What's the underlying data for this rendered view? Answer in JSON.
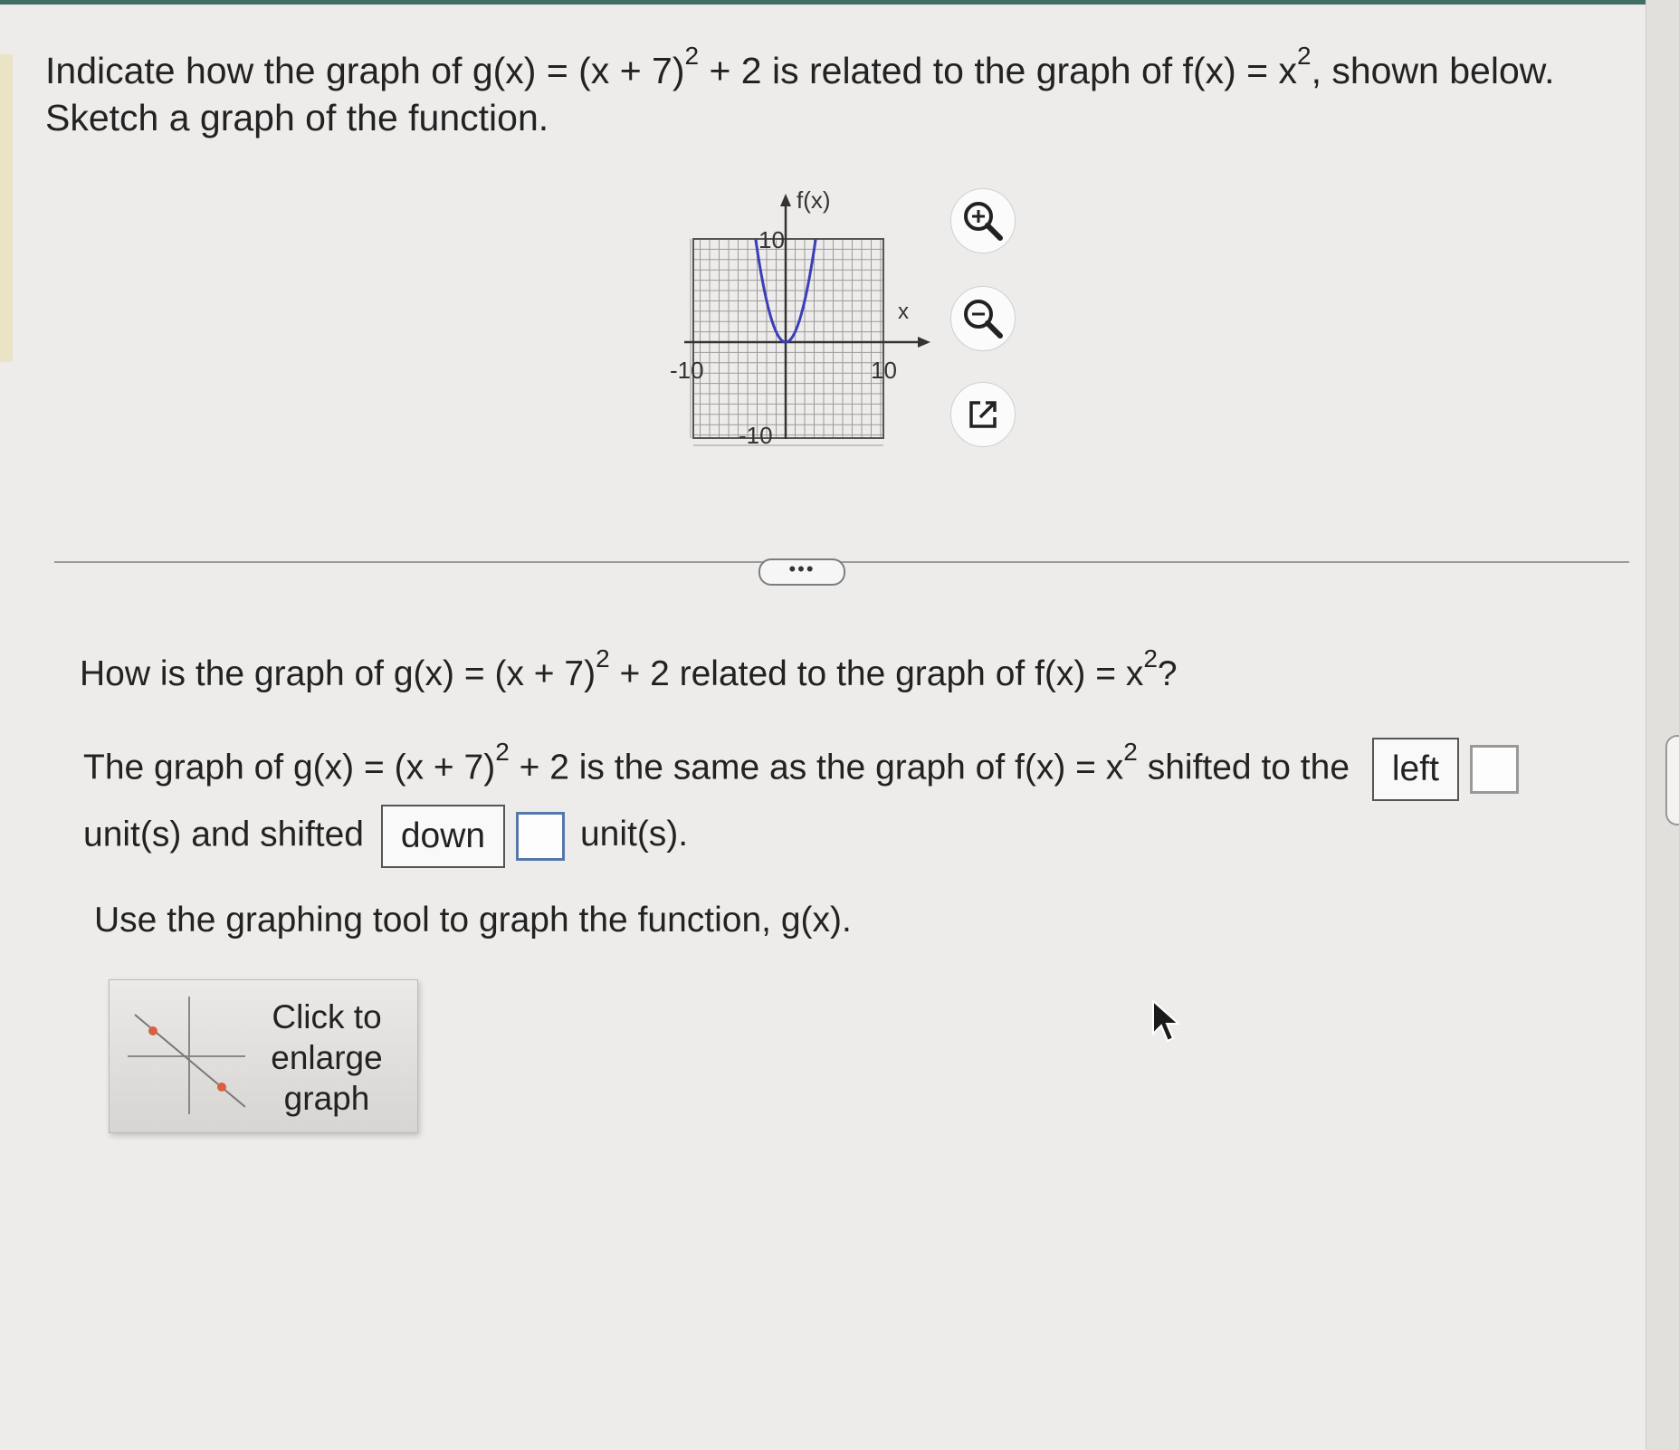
{
  "prompt": {
    "line1_a": "Indicate how the graph of g(x) = (x + 7)",
    "line1_exp1": "2",
    "line1_b": " + 2 is related to the graph of f(x) = x",
    "line1_exp2": "2",
    "line1_c": ", shown below.",
    "line2": "Sketch a graph of the function."
  },
  "graph": {
    "y_label": "f(x)",
    "x_label": "x",
    "x_min_label": "-10",
    "x_max_label": "10",
    "y_max_label": "10",
    "y_min_label": "-10",
    "curve_color": "#3a3fb8",
    "function": "x^2",
    "x_range": [
      -10,
      10
    ],
    "y_range": [
      -10,
      10
    ]
  },
  "tools": {
    "zoom_in": "zoom-in-icon",
    "zoom_out": "zoom-out-icon",
    "popout": "external-link-icon"
  },
  "divider": {
    "more_label": "•••"
  },
  "question": {
    "a": "How is the graph of g(x) = (x + 7)",
    "exp1": "2",
    "b": " + 2 related to the graph of f(x) = x",
    "exp2": "2",
    "c": "?"
  },
  "answer": {
    "a": "The graph of g(x) = (x + 7)",
    "exp1": "2",
    "b": " + 2 is the same as the graph of f(x) = x",
    "exp2": "2",
    "c": " shifted to the",
    "dir1_value": "left",
    "units1_value": "",
    "d": "unit(s) and shifted",
    "dir2_value": "down",
    "units2_value": "",
    "e": "unit(s)."
  },
  "instruction": "Use the graphing tool to graph the function, g(x).",
  "enlarge": {
    "line1": "Click to",
    "line2": "enlarge",
    "line3": "graph"
  }
}
